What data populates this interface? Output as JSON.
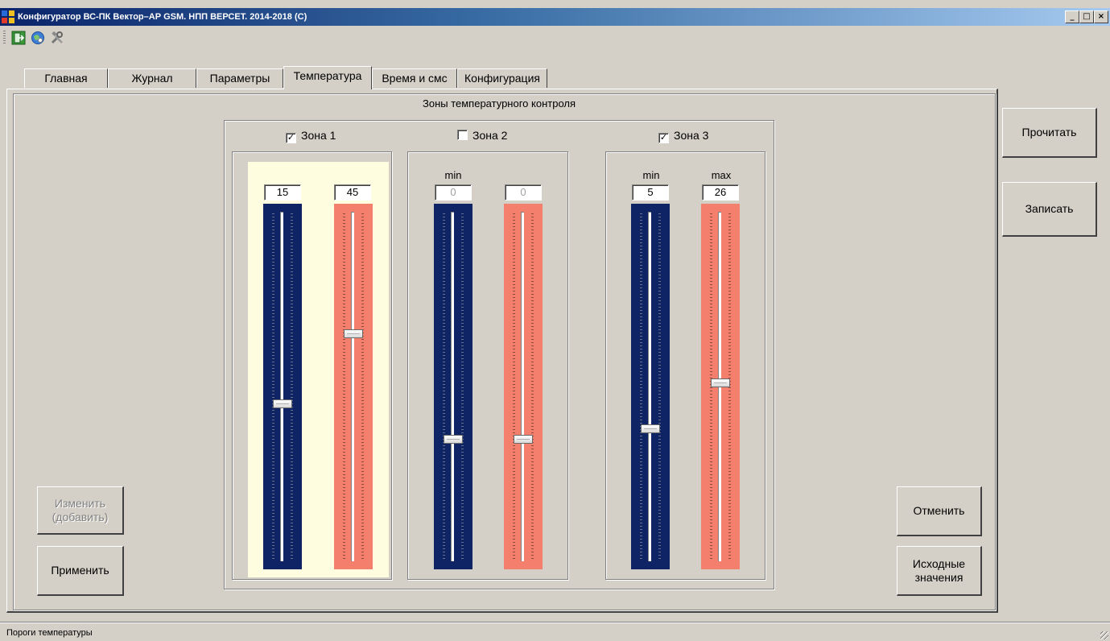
{
  "window": {
    "title": "Конфигуратор ВС-ПК Вектор–АР GSM. НПП ВЕРСЕТ. 2014-2018 (С)",
    "minimize_glyph": "_",
    "maximize_glyph": "□",
    "close_glyph": "×"
  },
  "toolbar": {
    "tools": [
      {
        "icon": "exit-icon"
      },
      {
        "icon": "info-globe-icon"
      },
      {
        "icon": "tools-icon"
      }
    ]
  },
  "tabs": [
    {
      "label": "Главная",
      "active": false
    },
    {
      "label": "Журнал",
      "active": false
    },
    {
      "label": "Параметры",
      "active": false
    },
    {
      "label": "Температура",
      "active": true
    },
    {
      "label": "Время и смс",
      "active": false
    },
    {
      "label": "Конфигурация",
      "active": false
    }
  ],
  "zones_panel": {
    "title": "Зоны температурного контроля",
    "zones": [
      {
        "label": "Зона 1",
        "checked": true,
        "highlight_color": "#fffde0",
        "min_label": "",
        "max_label": "",
        "min_value": "15",
        "max_value": "45",
        "min_position_fraction": 0.55,
        "max_position_fraction": 0.35,
        "enabled": true
      },
      {
        "label": "Зона 2",
        "checked": false,
        "min_label": "min",
        "max_label": "",
        "min_value": "0",
        "max_value": "0",
        "min_position_fraction": 0.65,
        "max_position_fraction": 0.65,
        "enabled": false
      },
      {
        "label": "Зона 3",
        "checked": true,
        "min_label": "min",
        "max_label": "max",
        "min_value": "5",
        "max_value": "26",
        "min_position_fraction": 0.62,
        "max_position_fraction": 0.49,
        "enabled": true
      }
    ]
  },
  "buttons": {
    "change": "Изменить (добавить)",
    "apply": "Применить",
    "cancel": "Отменить",
    "defaults": "Исходные значения",
    "read": "Прочитать",
    "write": "Записать"
  },
  "status": {
    "text": "Пороги температуры"
  },
  "colors": {
    "min_track": "#0f2465",
    "max_track": "#f47f6d",
    "window_bg": "#d4d0c8",
    "title_bar": "#0a246a"
  }
}
